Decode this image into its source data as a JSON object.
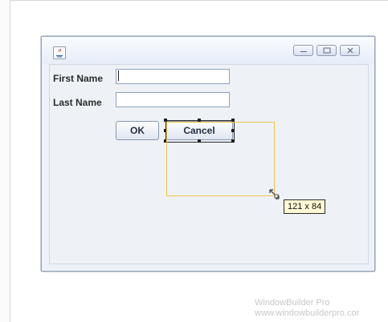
{
  "labels": {
    "first_name": "First Name",
    "last_name": "Last Name"
  },
  "inputs": {
    "first_name_value": "",
    "last_name_value": ""
  },
  "buttons": {
    "ok": "OK",
    "cancel": "Cancel"
  },
  "designer": {
    "resize_tooltip": "121 x 84"
  },
  "watermark": {
    "line1": "WindowBuilder Pro",
    "line2": "www.windowbuilderpro.cor"
  },
  "icons": {
    "title_icon": "java-icon",
    "minimize": "minimize-icon",
    "maximize": "maximize-icon",
    "close": "close-icon",
    "resize_cursor": "resize-cursor-icon"
  },
  "colors": {
    "selection_outline": "#f2c247",
    "window_border": "#9aa6b8",
    "tooltip_bg": "#fff9d6"
  }
}
